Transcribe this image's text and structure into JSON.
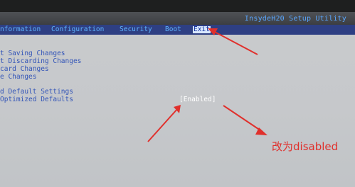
{
  "window": {
    "title": "InsydeH20 Setup Utility"
  },
  "menu": {
    "items": [
      {
        "label": "nformation"
      },
      {
        "label": "Configuration"
      },
      {
        "label": "Security"
      },
      {
        "label": "Boot"
      },
      {
        "label": "Exit",
        "active": true
      }
    ]
  },
  "exit_menu": {
    "options": [
      {
        "label": "t Saving Changes"
      },
      {
        "label": "t Discarding Changes"
      },
      {
        "label": "card Changes"
      },
      {
        "label": "e Changes"
      },
      {
        "label": "d Default Settings"
      },
      {
        "label": "Optimized Defaults",
        "value": "[Enabled]"
      }
    ]
  },
  "annotation": {
    "text": "改为disabled",
    "color": "#e0302c"
  }
}
